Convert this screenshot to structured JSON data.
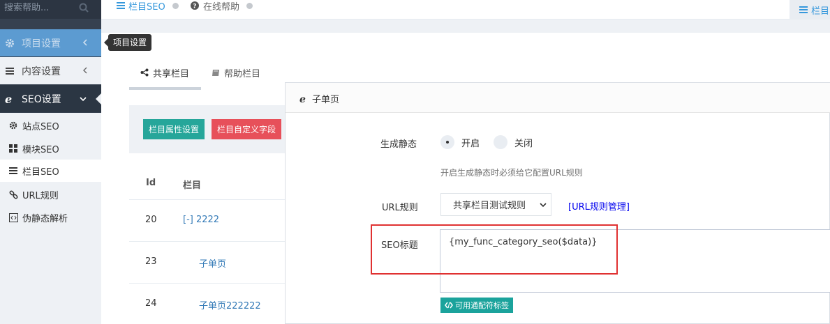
{
  "sidebar": {
    "search_placeholder": "搜索帮助...",
    "menu": [
      {
        "label": "项目设置"
      },
      {
        "label": "内容设置"
      },
      {
        "label": "SEO设置"
      }
    ],
    "submenu": [
      {
        "label": "站点SEO"
      },
      {
        "label": "模块SEO"
      },
      {
        "label": "栏目SEO"
      },
      {
        "label": "URL规则"
      },
      {
        "label": "伪静态解析"
      }
    ]
  },
  "tooltip": {
    "text": "项目设置"
  },
  "topbar": {
    "crumb1": "栏目SEO",
    "crumb2": "在线帮助",
    "right_label": "栏目"
  },
  "tabs": [
    {
      "label": "共享栏目"
    },
    {
      "label": "帮助栏目"
    }
  ],
  "toolbar": {
    "btn_attr": "栏目属性设置",
    "btn_custom": "栏目自定义字段"
  },
  "table": {
    "headers": [
      "Id",
      "栏目"
    ],
    "rows": [
      {
        "id": "20",
        "name": "[-] 2222"
      },
      {
        "id": "23",
        "name": "子单页"
      },
      {
        "id": "24",
        "name": "子单页222222"
      }
    ]
  },
  "modal": {
    "title": "子单页",
    "static_label": "生成静态",
    "radio_on": "开启",
    "radio_off": "关闭",
    "static_help": "开启生成静态时必须给它配置URL规则",
    "url_label": "URL规则",
    "url_select_value": "共享栏目测试规则",
    "url_manage_link": "[URL规则管理]",
    "seo_label": "SEO标题",
    "seo_value": "{my_func_category_seo($data)}",
    "tags_button": "可用通配符标签"
  },
  "colors": {
    "sidebar_bg": "#364150",
    "active_menu": "#5c9bd1",
    "btn_green": "#26a69a",
    "btn_red": "#e7505a",
    "highlight": "#e03131"
  }
}
